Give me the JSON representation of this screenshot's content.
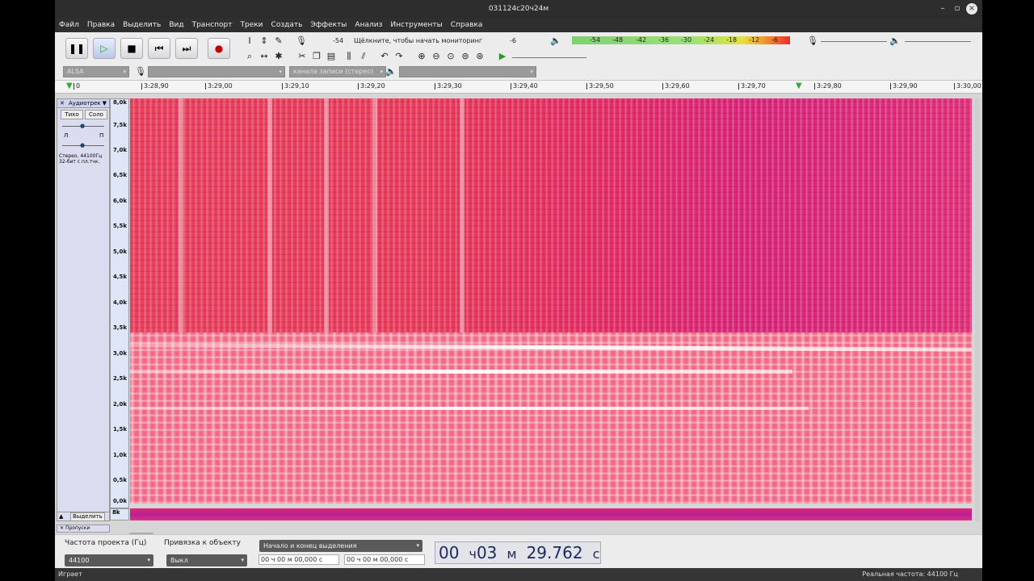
{
  "window": {
    "title": "031124с20ч24м"
  },
  "menu": [
    "Файл",
    "Правка",
    "Выделить",
    "Вид",
    "Транспорт",
    "Треки",
    "Создать",
    "Эффекты",
    "Анализ",
    "Инструменты",
    "Справка"
  ],
  "meters": {
    "record_label": "-54",
    "record_hint": "Щёлкните, чтобы начать мониторинг",
    "record_end": "-6",
    "play_scale": [
      "-54",
      "-48",
      "-42",
      "-36",
      "-30",
      "-24",
      "-18",
      "-12",
      "-6"
    ],
    "l": "Л",
    "r": "П"
  },
  "devices": {
    "host": "ALSA",
    "channels": "канала записи (стерео)"
  },
  "timeline": {
    "ticks": [
      "0",
      "3:28,90",
      "3:29,00",
      "3:29,10",
      "3:29,20",
      "3:29,30",
      "3:29,40",
      "3:29,50",
      "3:29,60",
      "3:29,70",
      "3:29,80",
      "3:29,90",
      "3:30,00"
    ]
  },
  "track": {
    "name": "Аудиотрек",
    "mute": "Тихо",
    "solo": "Соло",
    "pan_l": "Л",
    "pan_r": "П",
    "info": "Стерео, 44100Гц",
    "format": "32-бит с пл.тчк.",
    "select_btn": "Выделить",
    "next_track": "Пропуски"
  },
  "freq_labels": [
    "8,0k",
    "7,5k",
    "7,0k",
    "6,5k",
    "6,0k",
    "5,5k",
    "5,0k",
    "4,5k",
    "4,0k",
    "3,5k",
    "3,0k",
    "2,5k",
    "2,0k",
    "1,5k",
    "1,0k",
    "0,5k",
    "0,0k"
  ],
  "lower_label": "8k",
  "selection": {
    "rate_label": "Частота проекта (Гц)",
    "rate_value": "44100",
    "snap_label": "Привязка к объекту",
    "snap_value": "Выкл",
    "mode_value": "Начало и конец выделения",
    "start": "00 ч 00 м 00,000 с",
    "end": "00 ч 00 м 00,000 с",
    "time_h": "00",
    "unit_h": "ч",
    "time_m": "03",
    "unit_m": "м",
    "time_s": "29.762",
    "unit_s": "с"
  },
  "status": {
    "left": "Играет",
    "right": "Реальная частота: 44100 Гц"
  }
}
